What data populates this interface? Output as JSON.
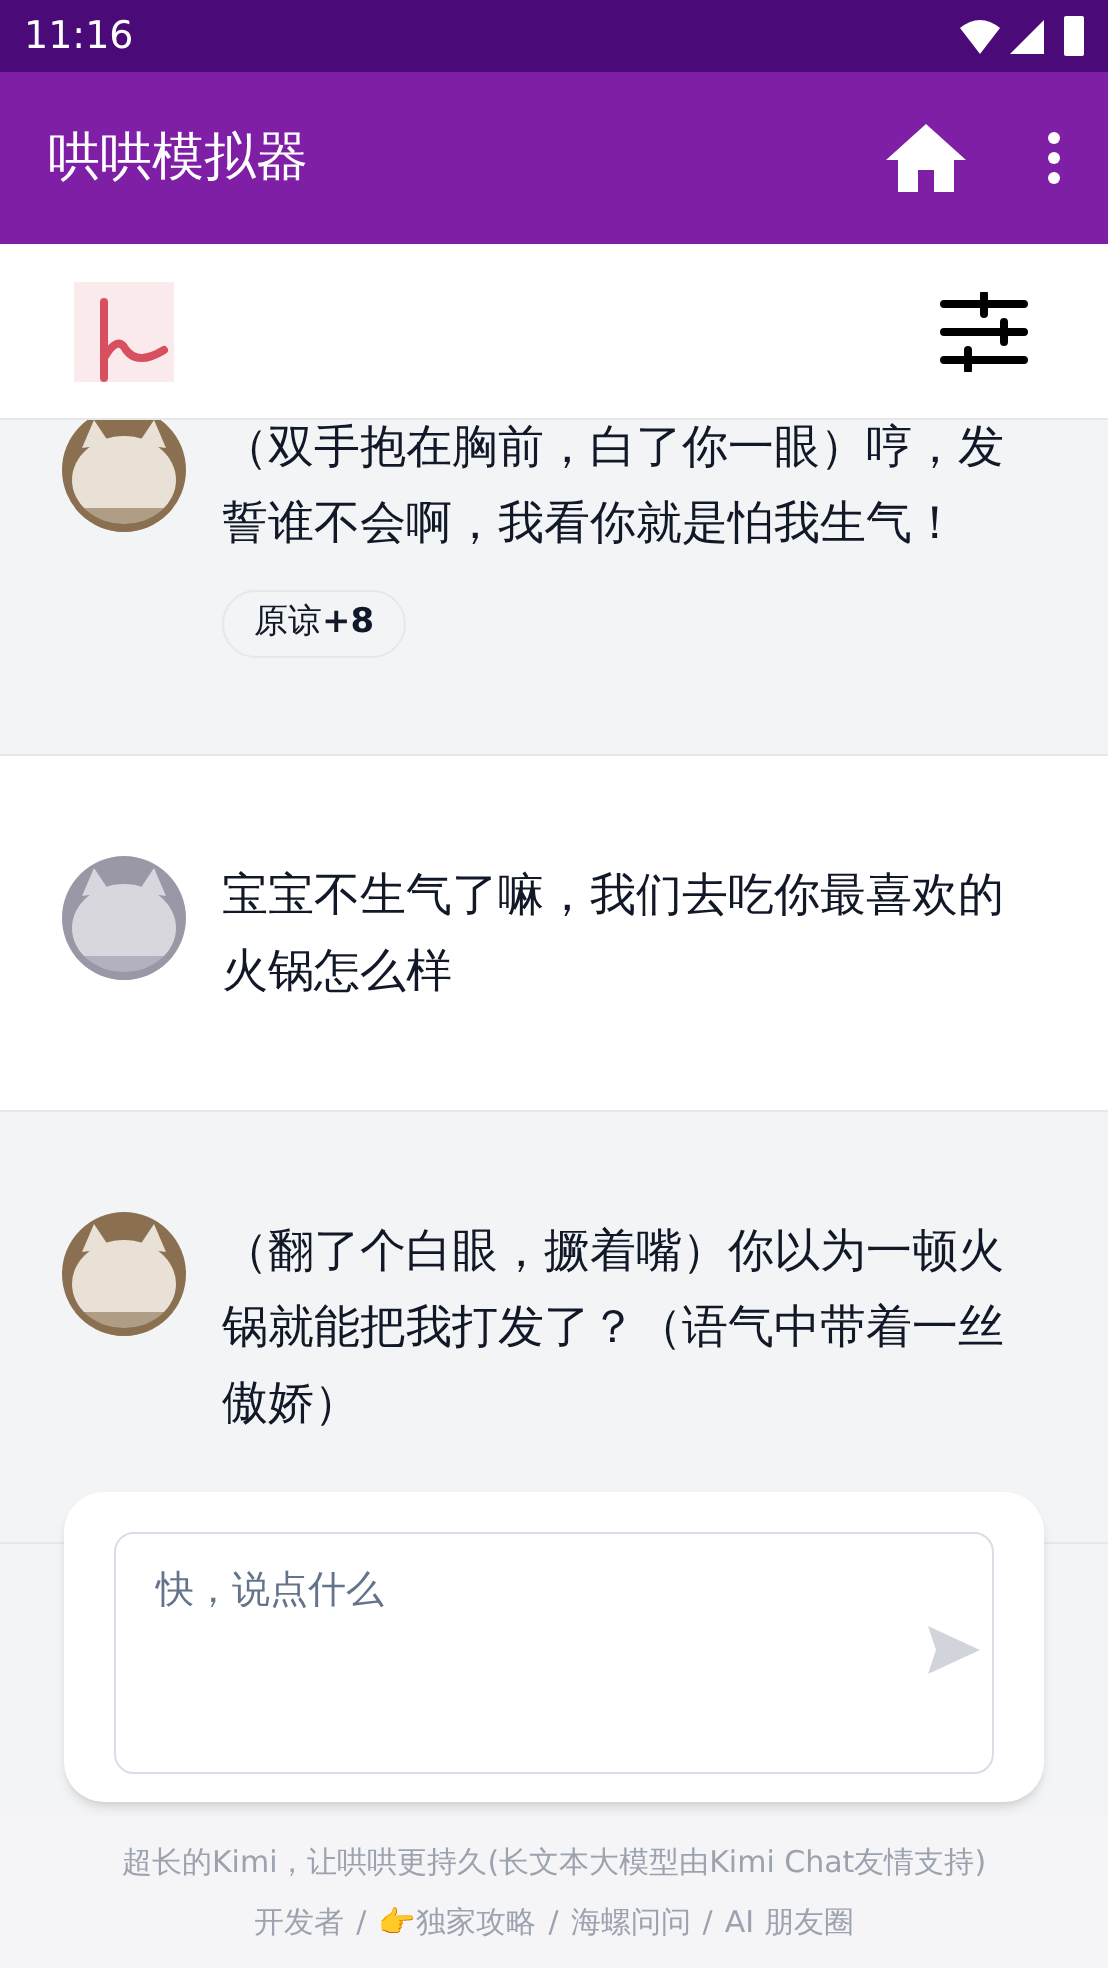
{
  "status_bar": {
    "time": "11:16"
  },
  "app_bar": {
    "title": "哄哄模拟器"
  },
  "messages": [
    {
      "kind": "reply",
      "text": "（双手抱在胸前，白了你一眼）哼，发誓谁不会啊，我看你就是怕我生气！",
      "badge": "原谅**+8**"
    },
    {
      "kind": "prompt",
      "text": "宝宝不生气了嘛，我们去吃你最喜欢的火锅怎么样"
    },
    {
      "kind": "reply",
      "text": "（翻了个白眼，撅着嘴）你以为一顿火锅就能把我打发了？（语气中带着一丝傲娇）"
    }
  ],
  "composer": {
    "placeholder": "快，说点什么"
  },
  "footer": {
    "notice": "超长的Kimi，让哄哄更持久(长文本大模型由Kimi Chat友情支持)",
    "separator": "/",
    "links": [
      "开发者",
      "👉独家攻略",
      "海螺问问",
      "AI 朋友圈"
    ]
  }
}
